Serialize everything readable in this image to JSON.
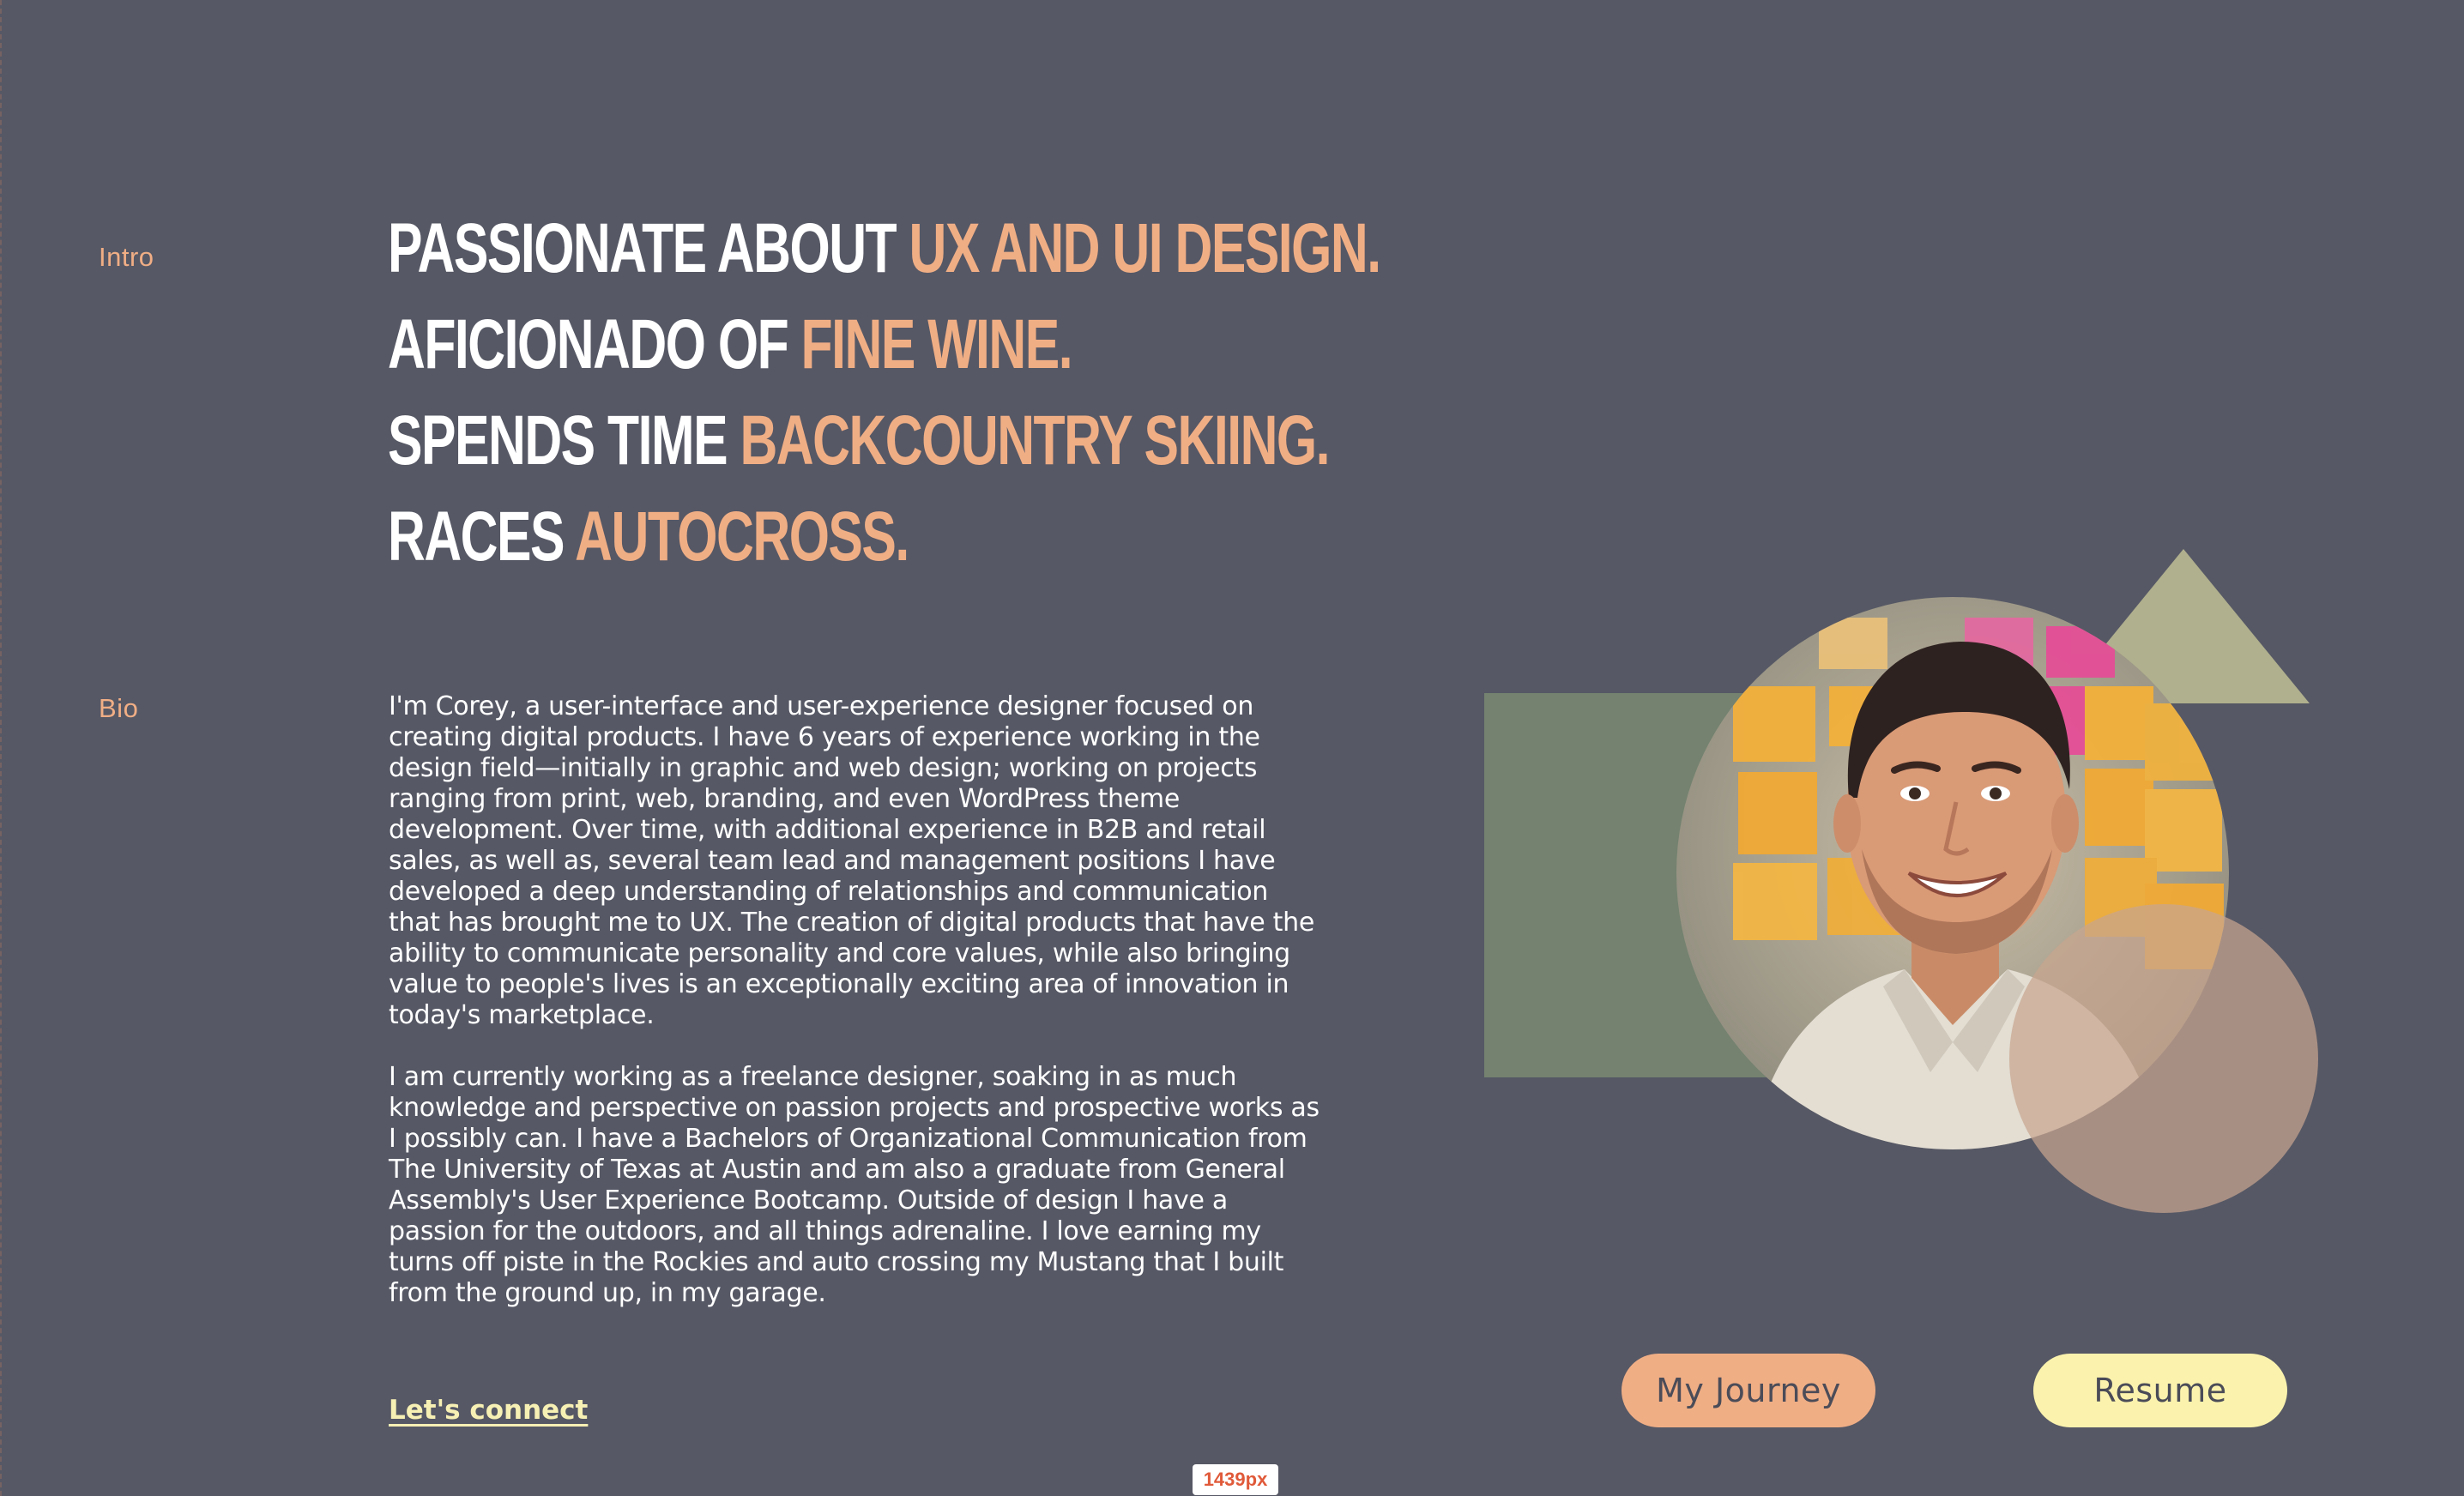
{
  "labels": {
    "intro": "Intro",
    "bio": "Bio"
  },
  "headline": [
    {
      "plain": "Passionate about ",
      "accent": "UX and UI design."
    },
    {
      "plain": "Aficionado of ",
      "accent": "fine wine."
    },
    {
      "plain": "Spends time ",
      "accent": "backcountry skiing."
    },
    {
      "plain": "Races ",
      "accent": "autocross."
    }
  ],
  "bio": {
    "paragraph_1": "I'm Corey, a user-interface and user-experience designer focused on creating digital products. I have 6 years of experience working in the design field—initially in graphic and web design; working on projects ranging from print, web, branding, and even WordPress theme development. Over time, with additional experience in B2B and retail sales, as well as, several team lead and management positions I have developed a deep understanding of relationships and communication that has brought me to UX. The creation of digital products that have the ability to communicate personality and core values, while also bringing value to people's lives is an exceptionally exciting area of innovation in today's marketplace.",
    "paragraph_2": "I am currently working as a freelance designer, soaking in as much knowledge and perspective on passion projects and prospective works as I possibly can. I have a Bachelors of Organizational Communication from The University of Texas at Austin and am also a graduate from General Assembly's User Experience Bootcamp. Outside of design I have a passion for the outdoors, and all things adrenaline. I love earning my turns off piste in the Rockies and auto crossing my Mustang that I built from the ground up, in my garage.",
    "connect_link": "Let's connect"
  },
  "buttons": {
    "journey": "My Journey",
    "resume": "Resume"
  },
  "dev_badge": "1439px",
  "colors": {
    "background": "#565865",
    "accent": "#f0ae85",
    "link": "#f7f0b4",
    "sage": "#74826f",
    "khaki": "#b0b08e",
    "tan": "#b0968a"
  },
  "images": {
    "portrait": "portrait-photo"
  }
}
